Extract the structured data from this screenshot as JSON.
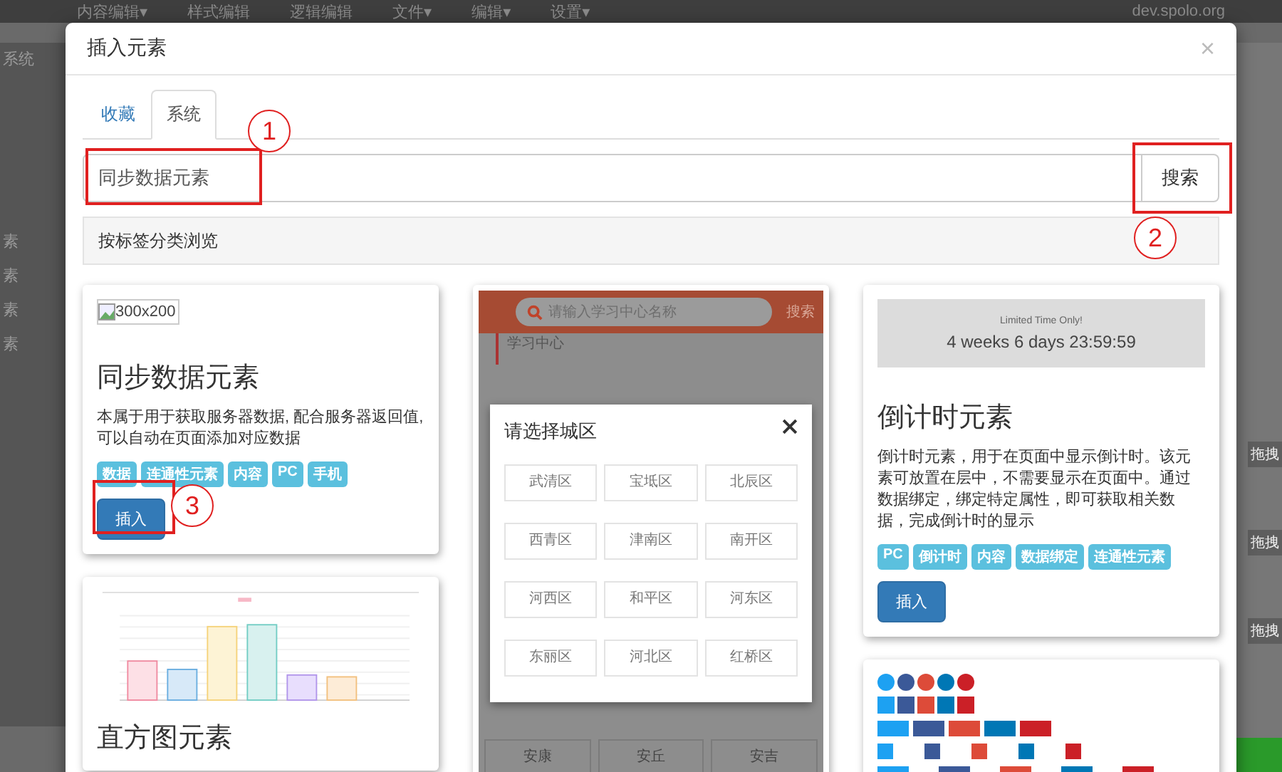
{
  "backdrop": {
    "menu": [
      {
        "label": "内容编辑▾"
      },
      {
        "label": "样式编辑"
      },
      {
        "label": "逻辑编辑"
      },
      {
        "label": "文件▾"
      },
      {
        "label": "编辑▾"
      },
      {
        "label": "设置▾"
      }
    ],
    "site": "dev.spolo.org",
    "sidebar": [
      "系统",
      "素",
      "素",
      "素",
      "素"
    ],
    "right_buttons": [
      "拖拽",
      "拖拽",
      "拖拽"
    ]
  },
  "dialog": {
    "title": "插入元素",
    "close": "×",
    "tabs": [
      {
        "label": "收藏",
        "selected": false
      },
      {
        "label": "系统",
        "selected": true
      }
    ],
    "search": {
      "value": "同步数据元素",
      "button": "搜索"
    },
    "category_bar": "按标签分类浏览",
    "columns": [
      [
        {
          "preview": {
            "kind": "broken_image",
            "alt": "300x200"
          },
          "title": "同步数据元素",
          "description": "本属于用于获取服务器数据, 配合服务器返回值, 可以自动在页面添加对应数据",
          "tags": [
            "数据",
            "连通性元素",
            "内容",
            "PC",
            "手机"
          ],
          "button": "插入"
        },
        {
          "preview": {
            "kind": "chart"
          },
          "title": "直方图元素"
        }
      ],
      [
        {
          "preview": {
            "kind": "mobile_screenshot",
            "search_placeholder": "请输入学习中心名称",
            "search_button": "搜索",
            "section": "学习中心",
            "dialog_title": "请选择城区",
            "districts": [
              "武清区",
              "宝坻区",
              "北辰区",
              "西青区",
              "津南区",
              "南开区",
              "河西区",
              "和平区",
              "河东区",
              "东丽区",
              "河北区",
              "红桥区"
            ],
            "more": [
              "安康",
              "安丘",
              "安吉"
            ]
          }
        }
      ],
      [
        {
          "preview": {
            "kind": "countdown",
            "caption": "Limited Time Only!",
            "time": "4 weeks 6 days 23:59:59"
          },
          "title": "倒计时元素",
          "description": "倒计时元素，用于在页面中显示倒计时。该元素可放置在层中，不需要显示在页面中。通过数据绑定，绑定特定属性，即可获取相关数据，完成倒计时的显示",
          "tags": [
            "PC",
            "倒计时",
            "内容",
            "数据绑定",
            "连通性元素"
          ],
          "button": "插入"
        },
        {
          "preview": {
            "kind": "social_buttons"
          }
        }
      ]
    ]
  },
  "annotations": [
    {
      "label": "1"
    },
    {
      "label": "2"
    },
    {
      "label": "3"
    }
  ]
}
